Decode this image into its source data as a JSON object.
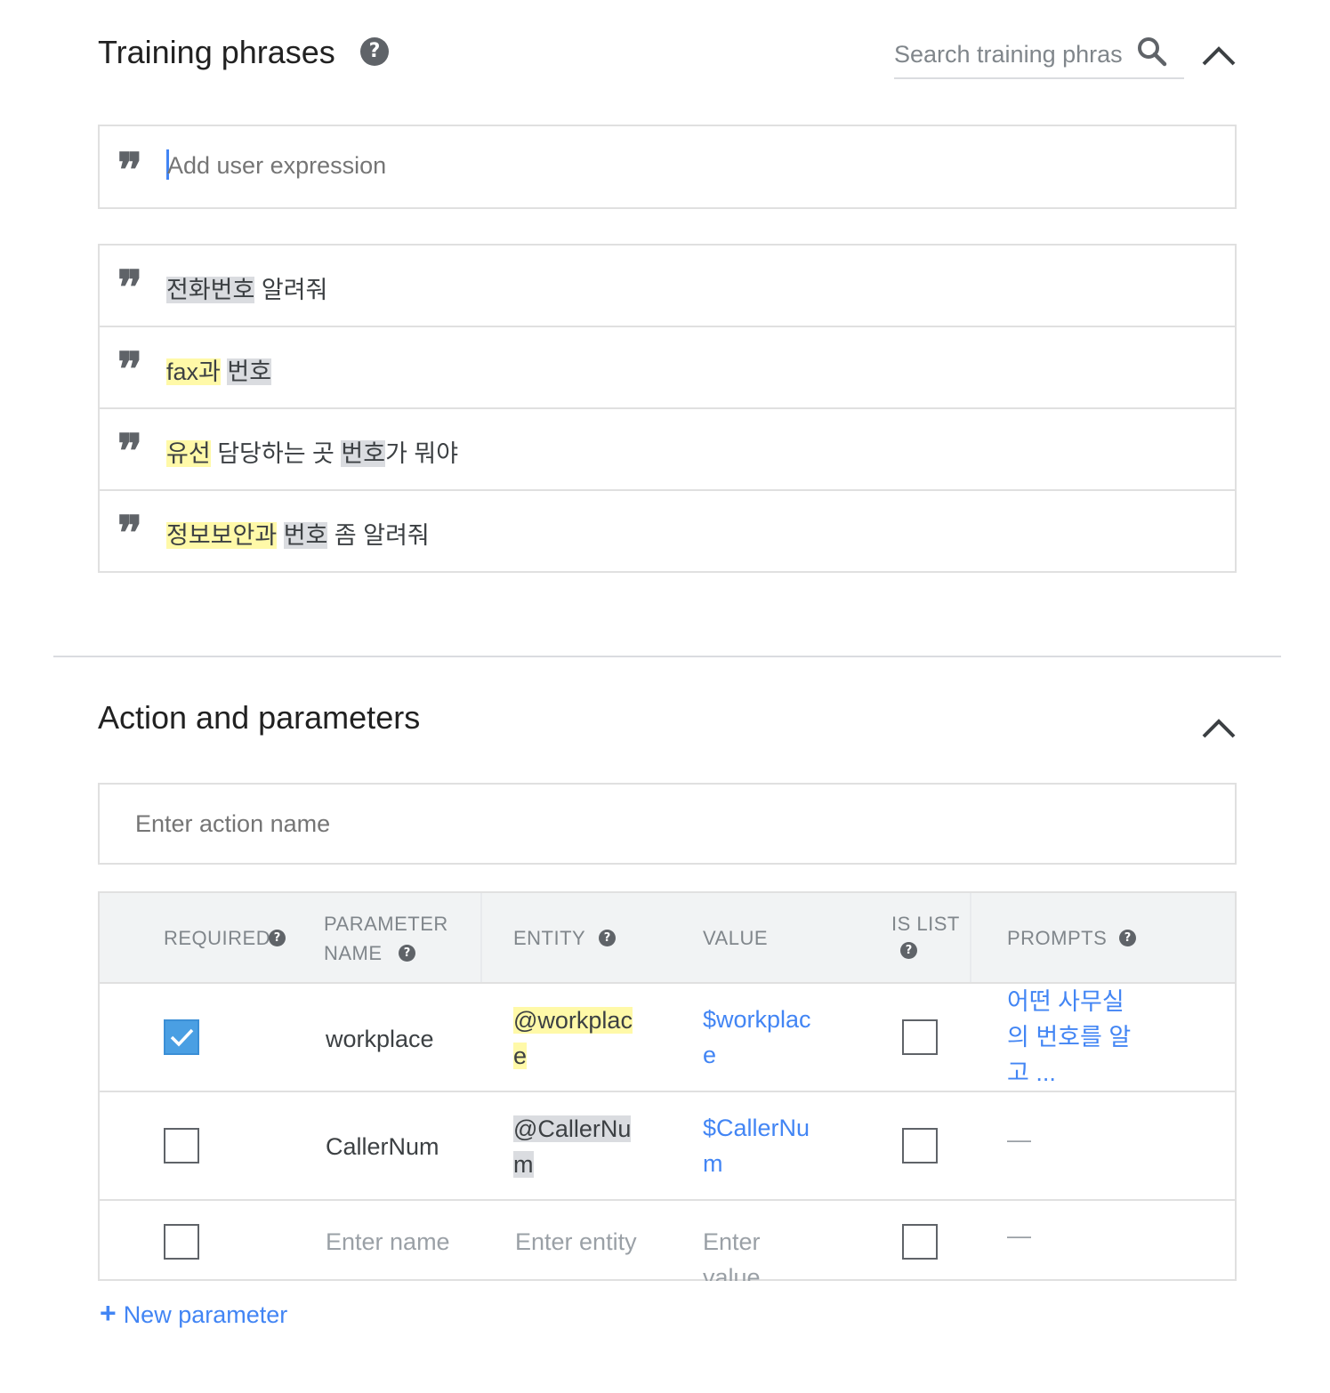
{
  "training": {
    "title": "Training phrases",
    "search_placeholder": "Search training phras",
    "add_placeholder": "Add user expression",
    "phrases": [
      {
        "parts": [
          {
            "text": "전화번호",
            "hl": "g"
          },
          {
            "text": " 알려줘",
            "hl": ""
          }
        ]
      },
      {
        "parts": [
          {
            "text": "fax과",
            "hl": "y"
          },
          {
            "text": " ",
            "hl": ""
          },
          {
            "text": "번호",
            "hl": "g"
          }
        ]
      },
      {
        "parts": [
          {
            "text": "유선",
            "hl": "y"
          },
          {
            "text": " 담당하는 곳 ",
            "hl": ""
          },
          {
            "text": "번호",
            "hl": "g"
          },
          {
            "text": "가 뭐야",
            "hl": ""
          }
        ]
      },
      {
        "parts": [
          {
            "text": "정보보안과",
            "hl": "y"
          },
          {
            "text": " ",
            "hl": ""
          },
          {
            "text": "번호",
            "hl": "g"
          },
          {
            "text": " 좀 알려줘",
            "hl": ""
          }
        ]
      }
    ]
  },
  "action": {
    "title": "Action and parameters",
    "action_placeholder": "Enter action name",
    "headers": {
      "required": "REQUIRED",
      "param_name_1": "PARAMETER",
      "param_name_2": "NAME",
      "entity": "ENTITY",
      "value": "VALUE",
      "is_list": "IS LIST",
      "prompts": "PROMPTS"
    },
    "rows": [
      {
        "required": true,
        "name": "workplace",
        "entity_1": "@workplac",
        "entity_2": "e",
        "value_1": "$workplac",
        "value_2": "e",
        "is_list": false,
        "prompt_1": "어떤 사무실",
        "prompt_2": "의 번호를 알",
        "prompt_3": "고 ..."
      },
      {
        "required": false,
        "name": "CallerNum",
        "entity_1": "@CallerNu",
        "entity_2": "m",
        "value_1": "$CallerNu",
        "value_2": "m",
        "is_list": false,
        "prompt_dash": "—"
      }
    ],
    "new_row": {
      "name_placeholder": "Enter name",
      "entity_placeholder": "Enter entity",
      "value_placeholder_1": "Enter",
      "value_placeholder_2": "value",
      "prompt_dash": "—"
    },
    "new_parameter": "New parameter"
  },
  "icons": {
    "help": "?",
    "quote": "❞",
    "plus": "+"
  },
  "colors": {
    "highlight_yellow": "#fff9a8",
    "highlight_gray": "#dadce0",
    "link_blue": "#4285f4",
    "checkbox_blue": "#4a9fe3"
  }
}
